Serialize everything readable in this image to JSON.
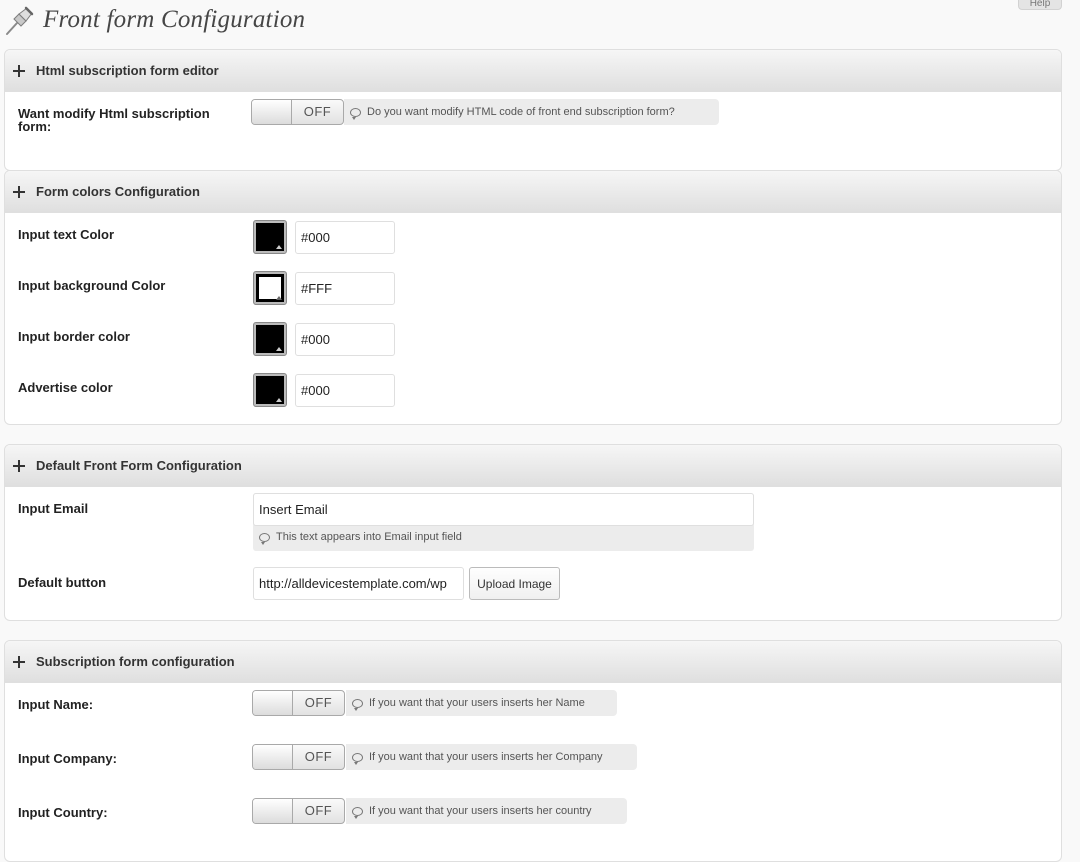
{
  "page": {
    "title": "Front form Configuration",
    "help_label": "Help"
  },
  "html_editor": {
    "header": "Html subscription form editor",
    "label": "Want modify Html subscription form:",
    "toggle_state": "OFF",
    "hint": "Do you want modify HTML code of front end subscription form?"
  },
  "colors": {
    "header": "Form colors Configuration",
    "items": [
      {
        "label": "Input text Color",
        "value": "#000",
        "swatch": "#000000"
      },
      {
        "label": "Input background Color",
        "value": "#FFF",
        "swatch": "#FFFFFF"
      },
      {
        "label": "Input border color",
        "value": "#000",
        "swatch": "#000000"
      },
      {
        "label": "Advertise color",
        "value": "#000",
        "swatch": "#000000"
      }
    ]
  },
  "default_form": {
    "header": "Default Front Form Configuration",
    "email_label": "Input Email",
    "email_value": "Insert Email",
    "email_hint": "This text appears into Email input field",
    "button_label": "Default button",
    "button_url": "http://alldevicestemplate.com/wp",
    "upload_label": "Upload Image"
  },
  "subscription": {
    "header": "Subscription form configuration",
    "items": [
      {
        "label": "Input Name:",
        "state": "OFF",
        "hint": "If you want that your users inserts her Name"
      },
      {
        "label": "Input Company:",
        "state": "OFF",
        "hint": "If you want that your users inserts her Company"
      },
      {
        "label": "Input Country:",
        "state": "OFF",
        "hint": "If you want that your users inserts her country"
      }
    ]
  }
}
